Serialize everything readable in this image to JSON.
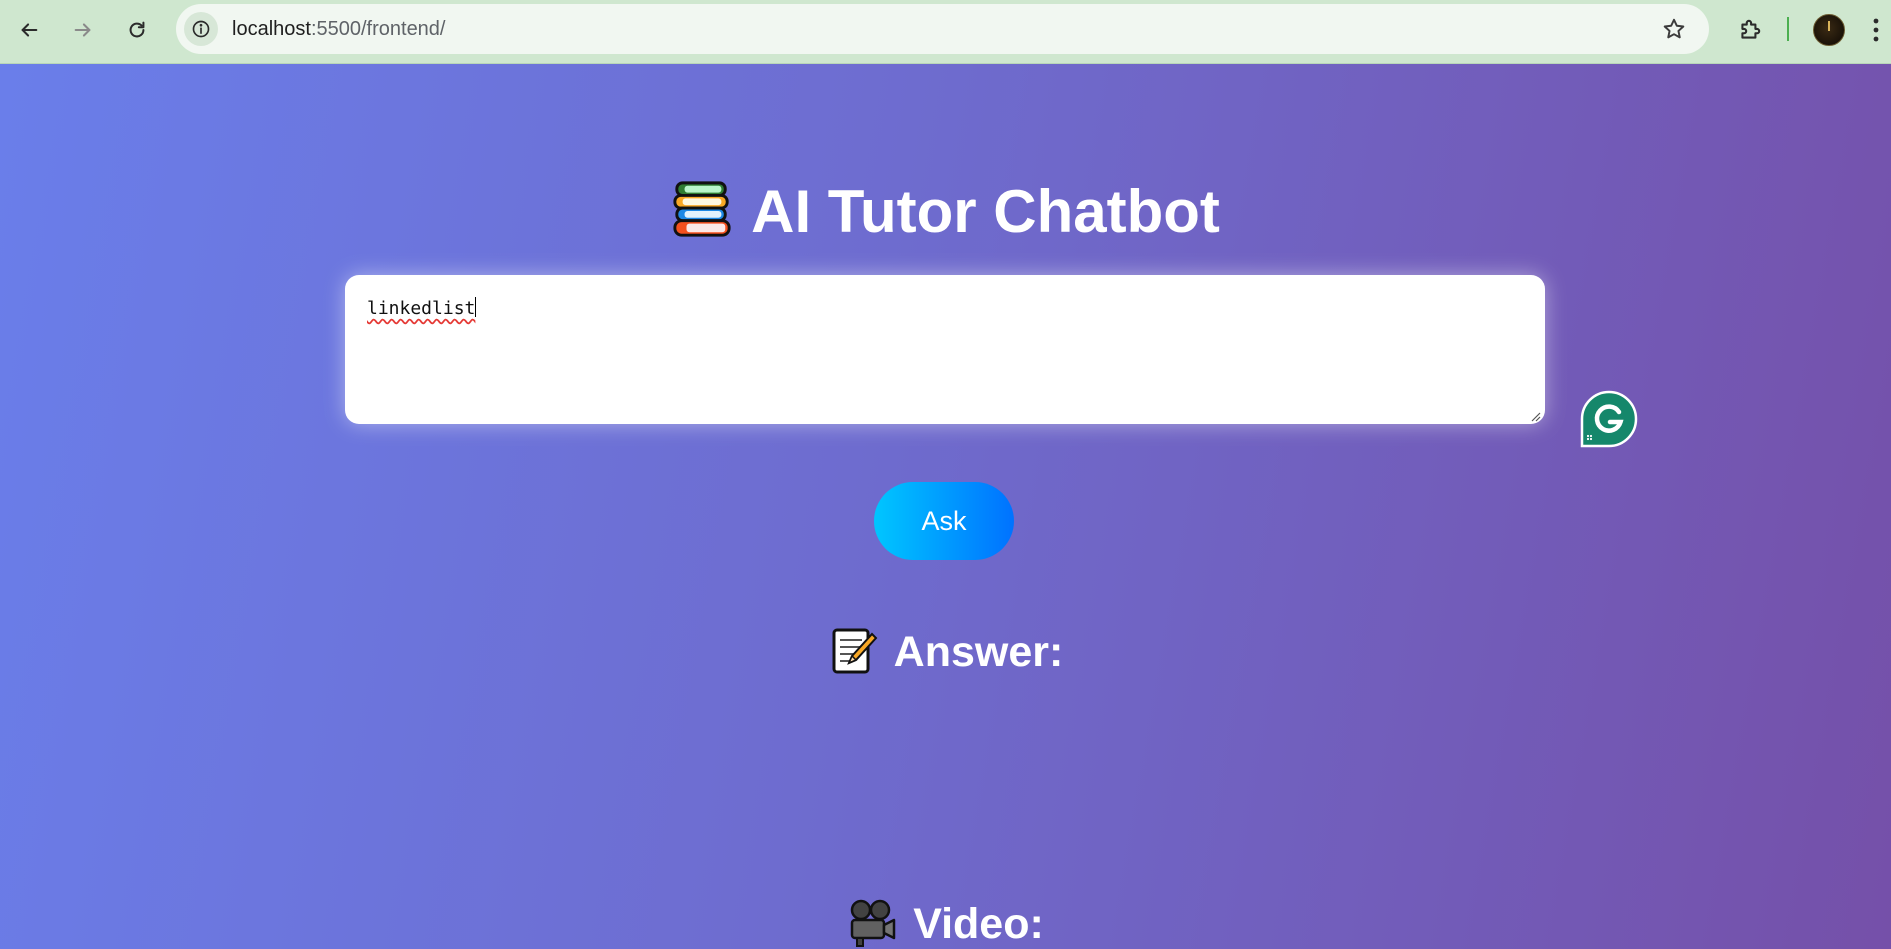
{
  "browser": {
    "url_host": "localhost",
    "url_rest": ":5500/frontend/",
    "icons": {
      "back": "arrow-left-icon",
      "forward": "arrow-right-icon",
      "reload": "reload-icon",
      "site_info": "info-icon",
      "bookmark": "star-icon",
      "extensions": "puzzle-icon",
      "profile": "avatar",
      "menu": "kebab-menu-icon"
    }
  },
  "page": {
    "title": "AI Tutor Chatbot",
    "title_icon": "books-icon",
    "question_value": "linkedlist",
    "ask_label": "Ask",
    "answer_heading": "Answer:",
    "answer_icon": "memo-icon",
    "video_heading": "Video:",
    "video_icon": "movie-camera-icon",
    "colors": {
      "gradient_start": "#6a7eea",
      "gradient_end": "#7550a9",
      "button_start": "#00c6ff",
      "button_end": "#0072ff",
      "grammarly": "#15876b"
    }
  }
}
